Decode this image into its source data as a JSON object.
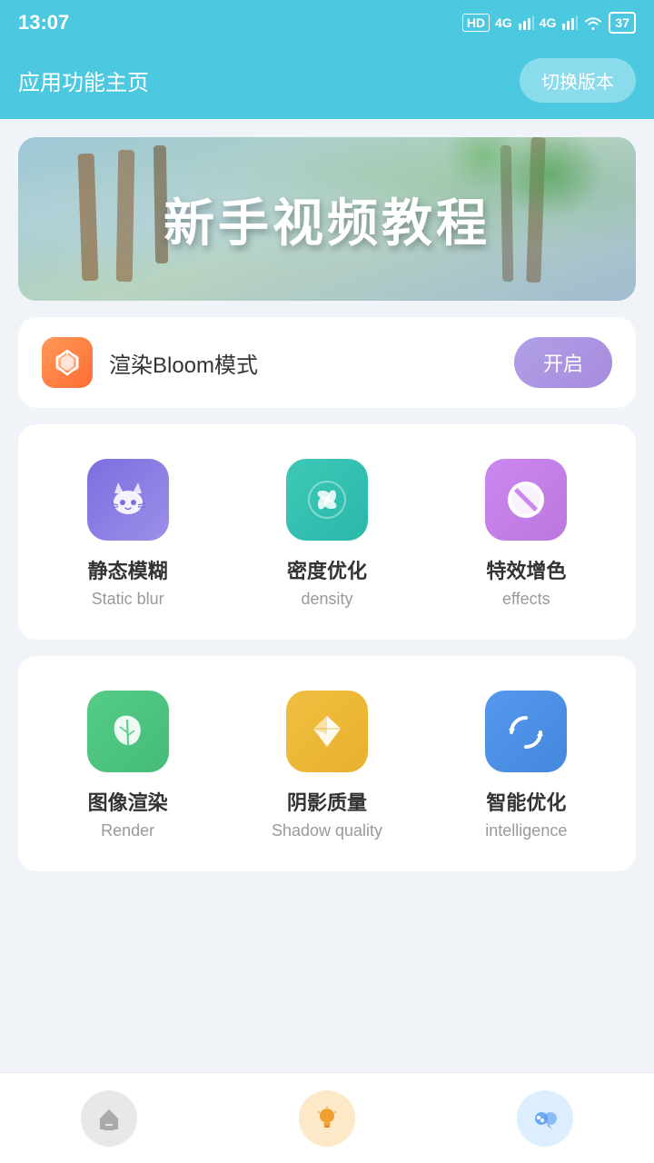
{
  "statusBar": {
    "time": "13:07",
    "batteryLevel": "37"
  },
  "header": {
    "title": "应用功能主页",
    "versionBtn": "切换版本"
  },
  "banner": {
    "text": "新手视频教程"
  },
  "bloomCard": {
    "label": "渲染Bloom模式",
    "buttonLabel": "开启"
  },
  "grid1": {
    "items": [
      {
        "title": "静态模糊",
        "subtitle": "Static blur",
        "iconClass": "icon-purple"
      },
      {
        "title": "密度优化",
        "subtitle": "density",
        "iconClass": "icon-teal"
      },
      {
        "title": "特效增色",
        "subtitle": "effects",
        "iconClass": "icon-violet"
      }
    ]
  },
  "grid2": {
    "items": [
      {
        "title": "图像渲染",
        "subtitle": "Render",
        "iconClass": "icon-green"
      },
      {
        "title": "阴影质量",
        "subtitle": "Shadow quality",
        "iconClass": "icon-yellow"
      },
      {
        "title": "智能优化",
        "subtitle": "intelligence",
        "iconClass": "icon-blue"
      }
    ]
  },
  "bottomNav": {
    "items": [
      {
        "label": "home",
        "icon": "home-icon",
        "state": "inactive"
      },
      {
        "label": "tips",
        "icon": "bulb-icon",
        "state": "active-orange"
      },
      {
        "label": "chat",
        "icon": "chat-icon",
        "state": "active-blue"
      }
    ]
  }
}
